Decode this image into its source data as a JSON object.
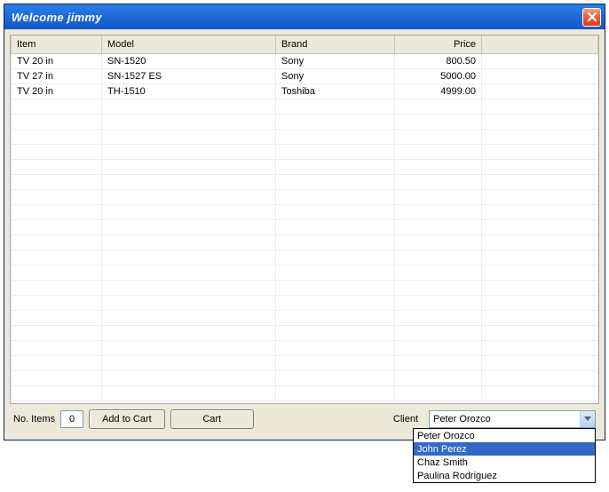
{
  "window": {
    "title": "Welcome jimmy"
  },
  "table": {
    "headers": {
      "item": "Item",
      "model": "Model",
      "brand": "Brand",
      "price": "Price"
    },
    "rows": [
      {
        "item": "TV 20 in",
        "model": "SN-1520",
        "brand": "Sony",
        "price": "800.50"
      },
      {
        "item": "TV 27 in",
        "model": "SN-1527 ES",
        "brand": "Sony",
        "price": "5000.00"
      },
      {
        "item": "TV 20 in",
        "model": "TH-1510",
        "brand": "Toshiba",
        "price": "4999.00"
      }
    ],
    "blank_rows": 20
  },
  "bottom": {
    "no_items_label": "No. Items",
    "no_items_value": "0",
    "add_to_cart": "Add to Cart",
    "cart": "Cart",
    "client_label": "Client",
    "client_selected": "Peter Orozco",
    "client_options": [
      "Peter Orozco",
      "John Perez",
      "Chaz Smith",
      "Paulina Rodriguez"
    ],
    "client_highlighted_index": 1
  }
}
